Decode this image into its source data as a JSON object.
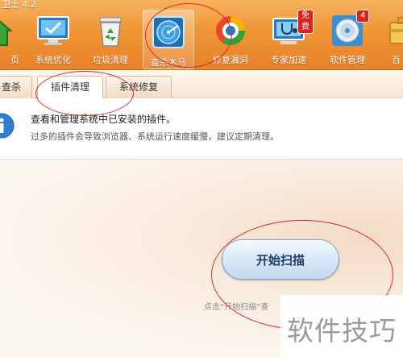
{
  "app": {
    "title": "卫士 4.2"
  },
  "toolbar": {
    "items": [
      {
        "id": "home",
        "label": "页",
        "icon": "house-icon"
      },
      {
        "id": "optimize",
        "label": "系统优化",
        "icon": "monitor-check-icon"
      },
      {
        "id": "cleanup",
        "label": "垃圾清理",
        "icon": "recycle-bin-icon"
      },
      {
        "id": "trojan",
        "label": "查杀木马",
        "icon": "radar-scan-icon",
        "active": true
      },
      {
        "id": "repair",
        "label": "修复漏洞",
        "icon": "repair-shield-icon"
      },
      {
        "id": "expert",
        "label": "专家加速",
        "icon": "stethoscope-monitor-icon",
        "badge": "免费"
      },
      {
        "id": "software",
        "label": "软件管理",
        "icon": "disc-icon",
        "badge": "4"
      },
      {
        "id": "toolbox",
        "label": "百",
        "icon": "toolbox-icon"
      }
    ]
  },
  "tabs": [
    {
      "label": "查杀",
      "active": false
    },
    {
      "label": "插件清理",
      "active": true
    },
    {
      "label": "系统修复",
      "active": false
    }
  ],
  "info": {
    "title": "查看和管理系统中已安装的插件。",
    "description": "过多的插件会导致浏览器、系统运行速度缓慢，建议定期清理。"
  },
  "scan": {
    "button_label": "开始扫描",
    "hint": "点击“开始扫描”查"
  },
  "watermark": "软件技巧",
  "colors": {
    "toolbar": "#ef9535",
    "annotation": "#d8282a",
    "button_text": "#1d3e63"
  }
}
